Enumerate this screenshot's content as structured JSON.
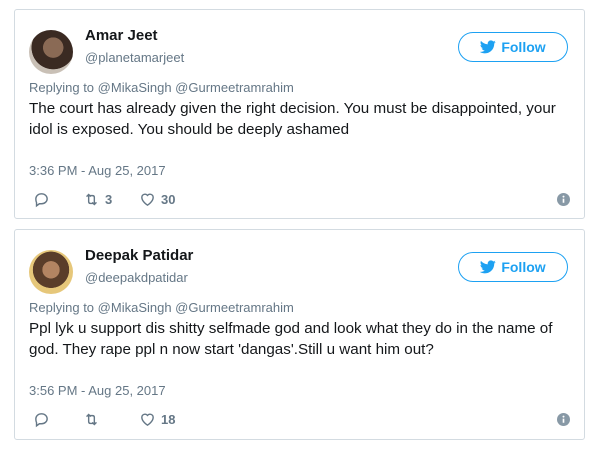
{
  "tweets": [
    {
      "name": "Amar Jeet",
      "handle": "@planetamarjeet",
      "follow_label": "Follow",
      "replying_prefix": "Replying to",
      "replying_to": "@MikaSingh @Gurmeetramrahim",
      "text": "The court has already given the right decision. You must be disappointed, your idol is exposed. You should be deeply ashamed",
      "timestamp": "3:36 PM - Aug 25, 2017",
      "retweets": "3",
      "likes": "30"
    },
    {
      "name": "Deepak Patidar",
      "handle": "@deepakdpatidar",
      "follow_label": "Follow",
      "replying_prefix": "Replying to",
      "replying_to": "@MikaSingh @Gurmeetramrahim",
      "text": "Ppl lyk u support dis shitty selfmade god and look what they do in the name of god. They rape ppl n now start 'dangas'.Still u want him out?",
      "timestamp": "3:56 PM - Aug 25, 2017",
      "retweets": "",
      "likes": "18"
    }
  ],
  "colors": {
    "accent": "#1da1f2",
    "muted": "#657786",
    "text": "#14171a",
    "border": "#d3dbe1"
  },
  "icons": [
    "bird-icon",
    "reply-icon",
    "retweet-icon",
    "heart-icon",
    "info-icon"
  ]
}
